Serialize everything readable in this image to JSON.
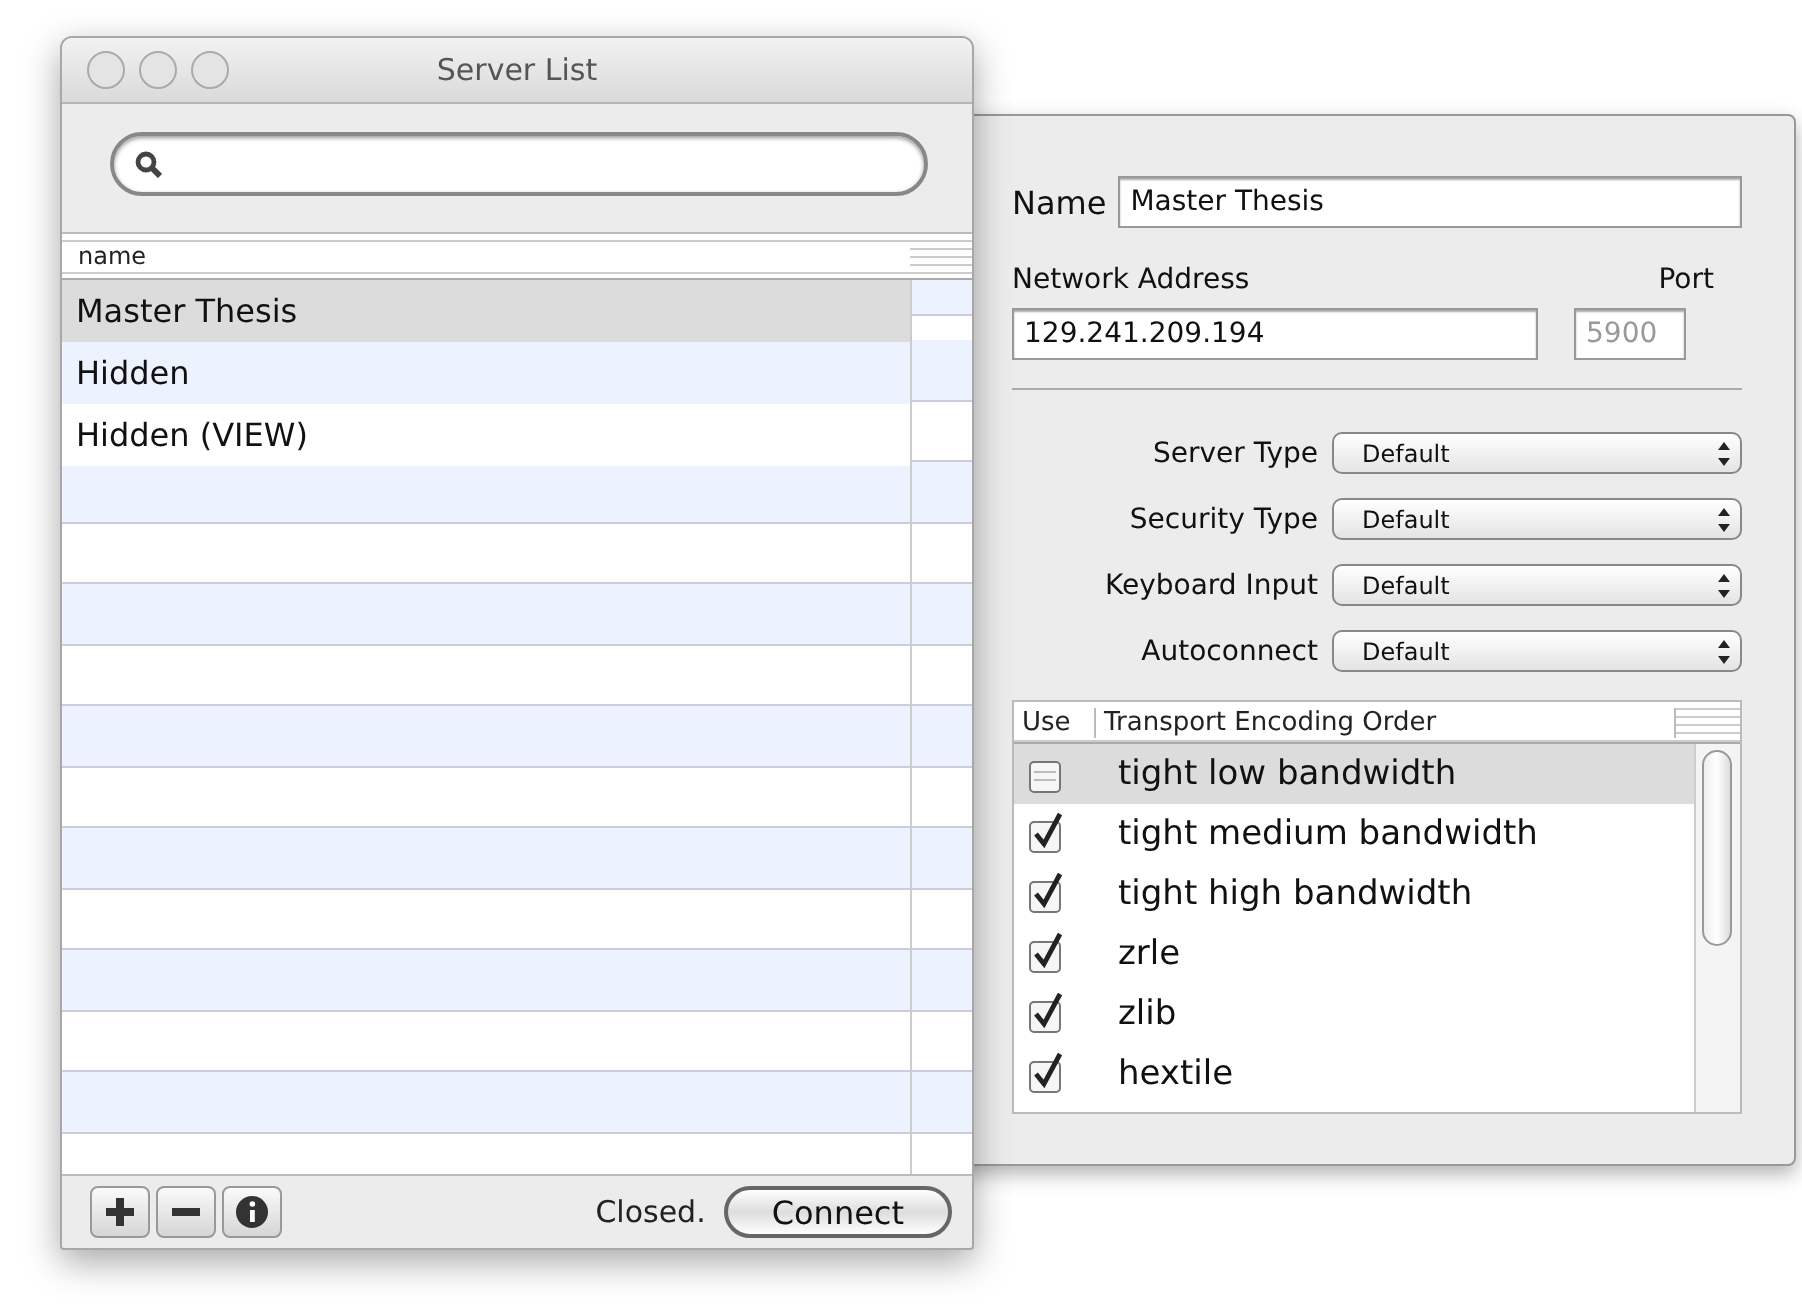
{
  "window": {
    "title": "Server List"
  },
  "server_table": {
    "columns": [
      "name"
    ],
    "rows": [
      {
        "name": "Master Thesis",
        "selected": true
      },
      {
        "name": "Hidden",
        "selected": false
      },
      {
        "name": "Hidden (VIEW)",
        "selected": false
      }
    ]
  },
  "bottom_bar": {
    "buttons": [
      {
        "kind": "add"
      },
      {
        "kind": "remove"
      },
      {
        "kind": "info"
      }
    ],
    "status": "Closed.",
    "connect_button": "Connect"
  },
  "details": {
    "name_label": "Name",
    "name_value": "Master Thesis",
    "address_label": "Network Address",
    "address_value": "129.241.209.194",
    "port_label": "Port",
    "port_placeholder": "5900",
    "popups": [
      {
        "label": "Server Type",
        "value": "Default"
      },
      {
        "label": "Security Type",
        "value": "Default"
      },
      {
        "label": "Keyboard Input",
        "value": "Default"
      },
      {
        "label": "Autoconnect",
        "value": "Default"
      }
    ],
    "encodings": {
      "columns": [
        "Use",
        "Transport Encoding Order"
      ],
      "rows": [
        {
          "name": "tight low bandwidth",
          "checked": false,
          "selected": true
        },
        {
          "name": "tight medium bandwidth",
          "checked": true,
          "selected": false
        },
        {
          "name": "tight high bandwidth",
          "checked": true,
          "selected": false
        },
        {
          "name": "zrle",
          "checked": true,
          "selected": false
        },
        {
          "name": "zlib",
          "checked": true,
          "selected": false
        },
        {
          "name": "hextile",
          "checked": true,
          "selected": false
        }
      ]
    }
  }
}
